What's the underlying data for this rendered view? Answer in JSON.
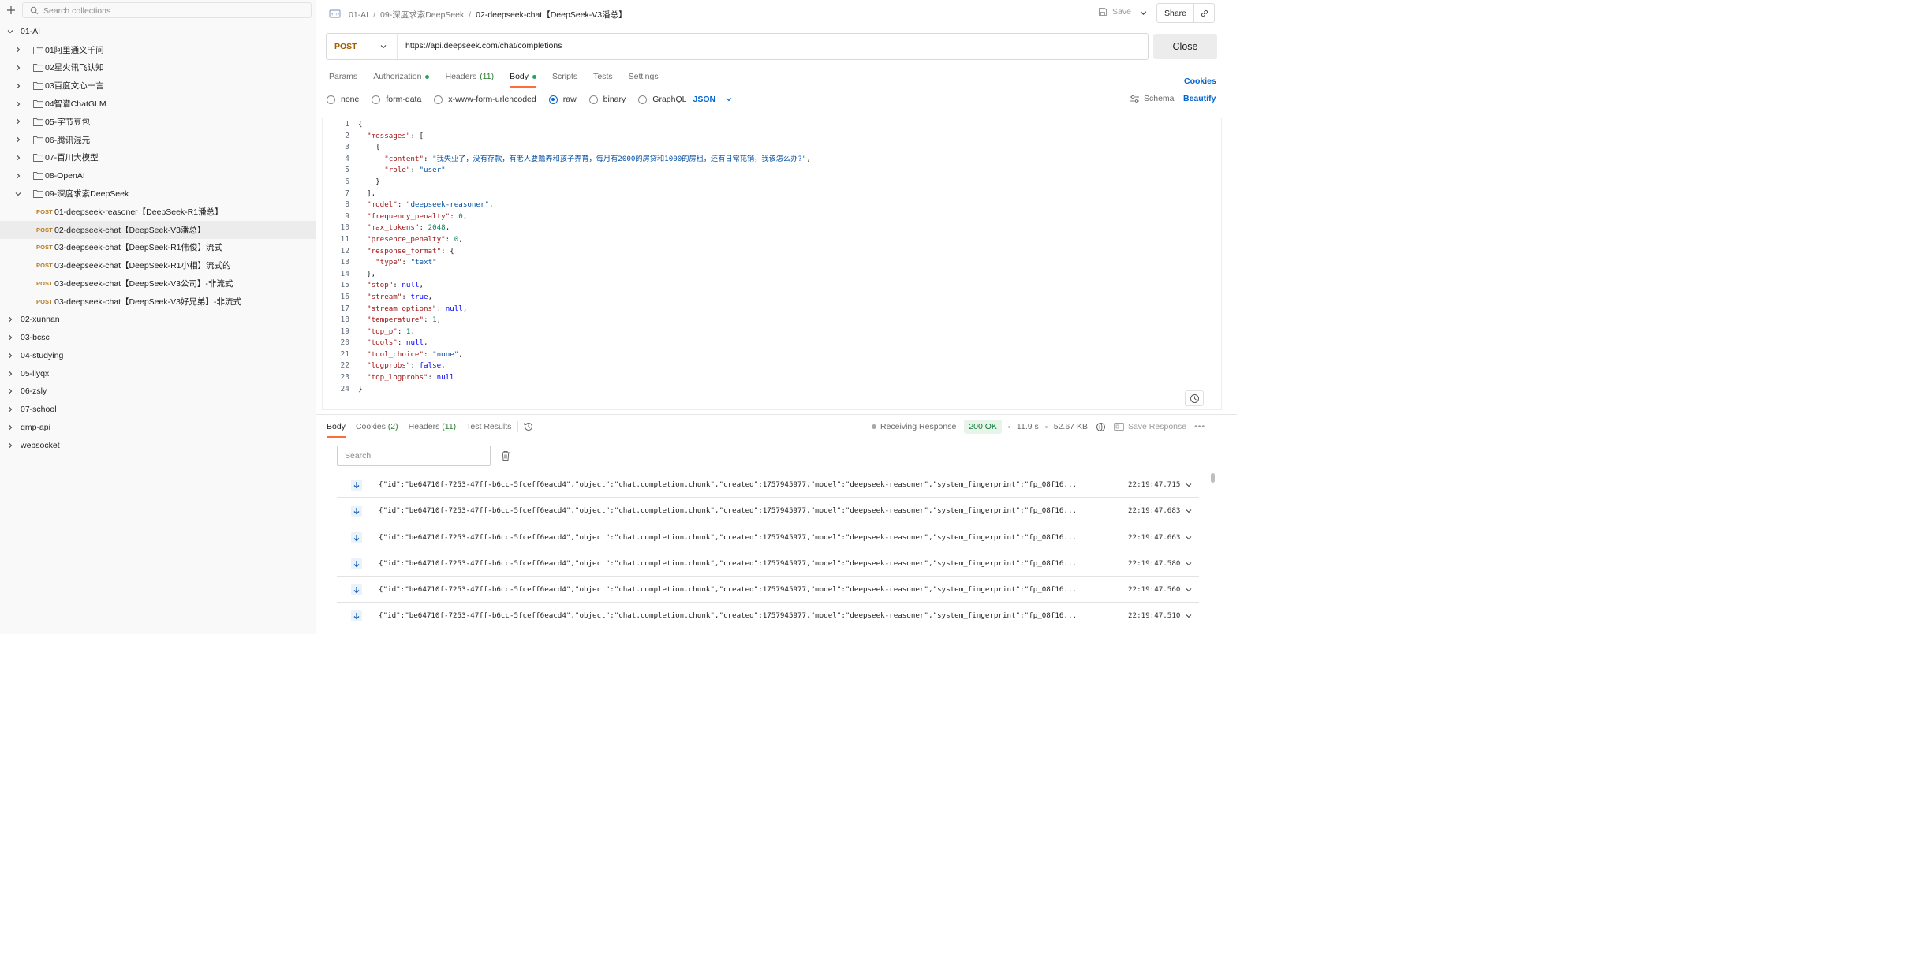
{
  "sidebar": {
    "search_placeholder": "Search collections",
    "collections": [
      {
        "label": "01-AI",
        "expanded": true
      },
      {
        "label": "02-xunnan"
      },
      {
        "label": "03-bcsc"
      },
      {
        "label": "04-studying"
      },
      {
        "label": "05-llyqx"
      },
      {
        "label": "06-zsly"
      },
      {
        "label": "07-school"
      },
      {
        "label": "qmp-api"
      },
      {
        "label": "websocket"
      }
    ],
    "folders": [
      {
        "label": "01阿里通义千问"
      },
      {
        "label": "02星火讯飞认知"
      },
      {
        "label": "03百度文心一言"
      },
      {
        "label": "04智谱ChatGLM"
      },
      {
        "label": "05-字节豆包"
      },
      {
        "label": "06-腾讯混元"
      },
      {
        "label": "07-百川大模型"
      },
      {
        "label": "08-OpenAI"
      },
      {
        "label": "09-深度求索DeepSeek",
        "expanded": true
      }
    ],
    "requests": [
      {
        "method": "POST",
        "label": "01-deepseek-reasoner【DeepSeek-R1潘总】"
      },
      {
        "method": "POST",
        "label": "02-deepseek-chat【DeepSeek-V3潘总】",
        "selected": true
      },
      {
        "method": "POST",
        "label": "03-deepseek-chat【DeepSeek-R1伟俊】流式"
      },
      {
        "method": "POST",
        "label": "03-deepseek-chat【DeepSeek-R1小相】流式的"
      },
      {
        "method": "POST",
        "label": "03-deepseek-chat【DeepSeek-V3公司】-非流式"
      },
      {
        "method": "POST",
        "label": "03-deepseek-chat【DeepSeek-V3好兄弟】-非流式"
      }
    ]
  },
  "header": {
    "breadcrumb": [
      "01-AI",
      "09-深度求索DeepSeek",
      "02-deepseek-chat【DeepSeek-V3潘总】"
    ],
    "save_label": "Save",
    "share_label": "Share"
  },
  "request": {
    "method": "POST",
    "url": "https://api.deepseek.com/chat/completions",
    "close_label": "Close",
    "tabs": [
      {
        "label": "Params"
      },
      {
        "label": "Authorization",
        "dot": true
      },
      {
        "label": "Headers",
        "count": "(11)"
      },
      {
        "label": "Body",
        "dot": true,
        "active": true
      },
      {
        "label": "Scripts"
      },
      {
        "label": "Tests"
      },
      {
        "label": "Settings"
      }
    ],
    "cookies_label": "Cookies",
    "body_types": [
      {
        "label": "none"
      },
      {
        "label": "form-data"
      },
      {
        "label": "x-www-form-urlencoded"
      },
      {
        "label": "raw",
        "selected": true
      },
      {
        "label": "binary"
      },
      {
        "label": "GraphQL"
      }
    ],
    "format": "JSON",
    "schema_label": "Schema",
    "beautify_label": "Beautify",
    "body_lines": [
      "{",
      "  \"messages\": [",
      "    {",
      "      \"content\": \"我失业了，没有存款，有老人要赡养和孩子养育，每月有2000的房贷和1000的房租，还有日常花销，我该怎么办?\",",
      "      \"role\": \"user\"",
      "    }",
      "  ],",
      "  \"model\": \"deepseek-reasoner\",",
      "  \"frequency_penalty\": 0,",
      "  \"max_tokens\": 2048,",
      "  \"presence_penalty\": 0,",
      "  \"response_format\": {",
      "    \"type\": \"text\"",
      "  },",
      "  \"stop\": null,",
      "  \"stream\": true,",
      "  \"stream_options\": null,",
      "  \"temperature\": 1,",
      "  \"top_p\": 1,",
      "  \"tools\": null,",
      "  \"tool_choice\": \"none\",",
      "  \"logprobs\": false,",
      "  \"top_logprobs\": null",
      "}"
    ]
  },
  "response": {
    "tabs": [
      {
        "label": "Body",
        "active": true
      },
      {
        "label": "Cookies",
        "count": "(2)"
      },
      {
        "label": "Headers",
        "count": "(11)"
      },
      {
        "label": "Test Results"
      }
    ],
    "receiving_label": "Receiving Response",
    "status": "200 OK",
    "time": "11.9 s",
    "size": "52.67 KB",
    "save_response_label": "Save Response",
    "search_placeholder": "Search",
    "events": [
      {
        "text": "{\"id\":\"be64710f-7253-47ff-b6cc-5fceff6eacd4\",\"object\":\"chat.completion.chunk\",\"created\":1757945977,\"model\":\"deepseek-reasoner\",\"system_fingerprint\":\"fp_08f16...",
        "time": "22:19:47.715"
      },
      {
        "text": "{\"id\":\"be64710f-7253-47ff-b6cc-5fceff6eacd4\",\"object\":\"chat.completion.chunk\",\"created\":1757945977,\"model\":\"deepseek-reasoner\",\"system_fingerprint\":\"fp_08f16...",
        "time": "22:19:47.683"
      },
      {
        "text": "{\"id\":\"be64710f-7253-47ff-b6cc-5fceff6eacd4\",\"object\":\"chat.completion.chunk\",\"created\":1757945977,\"model\":\"deepseek-reasoner\",\"system_fingerprint\":\"fp_08f16...",
        "time": "22:19:47.663"
      },
      {
        "text": "{\"id\":\"be64710f-7253-47ff-b6cc-5fceff6eacd4\",\"object\":\"chat.completion.chunk\",\"created\":1757945977,\"model\":\"deepseek-reasoner\",\"system_fingerprint\":\"fp_08f16...",
        "time": "22:19:47.580"
      },
      {
        "text": "{\"id\":\"be64710f-7253-47ff-b6cc-5fceff6eacd4\",\"object\":\"chat.completion.chunk\",\"created\":1757945977,\"model\":\"deepseek-reasoner\",\"system_fingerprint\":\"fp_08f16...",
        "time": "22:19:47.560"
      },
      {
        "text": "{\"id\":\"be64710f-7253-47ff-b6cc-5fceff6eacd4\",\"object\":\"chat.completion.chunk\",\"created\":1757945977,\"model\":\"deepseek-reasoner\",\"system_fingerprint\":\"fp_08f16...",
        "time": "22:19:47.510"
      }
    ]
  },
  "icons": {
    "chevron": "chevron-icon",
    "folder": "folder-icon",
    "http": "http-icon",
    "event_arrow": "arrow-down-icon"
  },
  "colors": {
    "accent": "#ff6c37",
    "link": "#0265d2",
    "post_method": "#b7791f",
    "status_ok_bg": "#e6f4ea",
    "status_ok_fg": "#0f7a3a"
  }
}
